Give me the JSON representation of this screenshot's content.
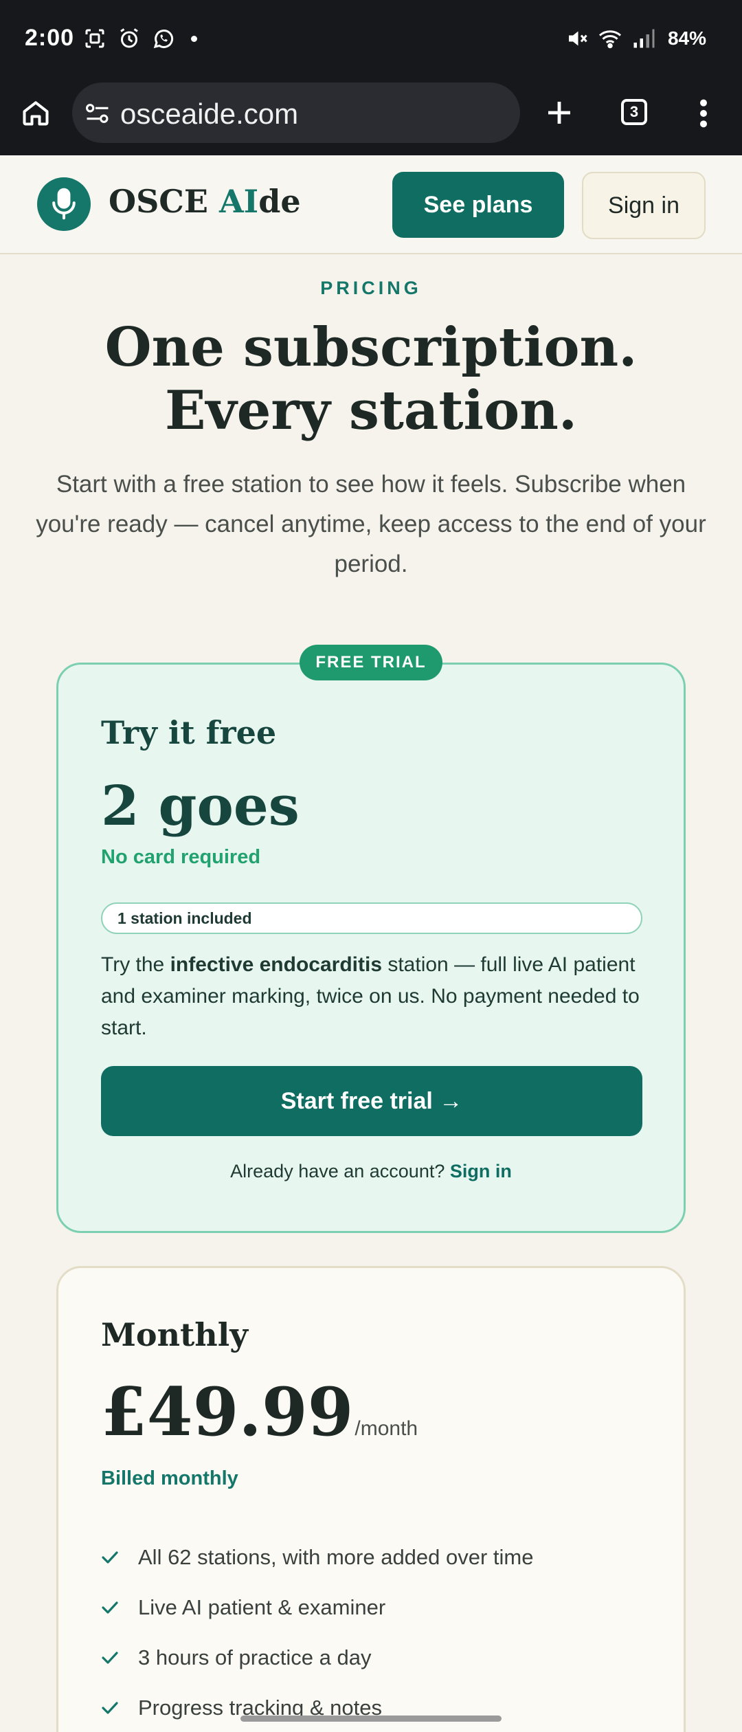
{
  "status_bar": {
    "time": "2:00",
    "battery": "84%",
    "icons": [
      "screenshot-icon",
      "alarm-icon",
      "whatsapp-icon",
      "mute-icon",
      "wifi-icon",
      "signal-icon"
    ]
  },
  "browser": {
    "url": "osceaide.com",
    "tab_count": "3"
  },
  "site": {
    "brand_prefix": "OSCE ",
    "brand_accent": "AI",
    "brand_suffix": "de",
    "see_plans": "See plans",
    "sign_in": "Sign in",
    "accent_color": "#0f6e61"
  },
  "hero": {
    "eyebrow": "PRICING",
    "title": "One subscription. Every station.",
    "subtitle": "Start with a free station to see how it feels. Subscribe when you're ready — cancel anytime, keep access to the end of your period."
  },
  "trial": {
    "badge": "FREE TRIAL",
    "title": "Try it free",
    "amount": "2 goes",
    "note": "No card required",
    "pill": "1 station included",
    "desc_pre": "Try the ",
    "desc_bold": "infective endocarditis",
    "desc_post": " station — full live AI patient and examiner marking, twice on us. No payment needed to start.",
    "cta": "Start free trial →",
    "account_prompt": "Already have an account? ",
    "account_link": "Sign in"
  },
  "monthly": {
    "title": "Monthly",
    "price": "£49.99",
    "period": "/month",
    "billing": "Billed monthly",
    "features": [
      "All 62 stations, with more added over time",
      "Live AI patient & examiner",
      "3 hours of practice a day",
      "Progress tracking & notes"
    ]
  }
}
